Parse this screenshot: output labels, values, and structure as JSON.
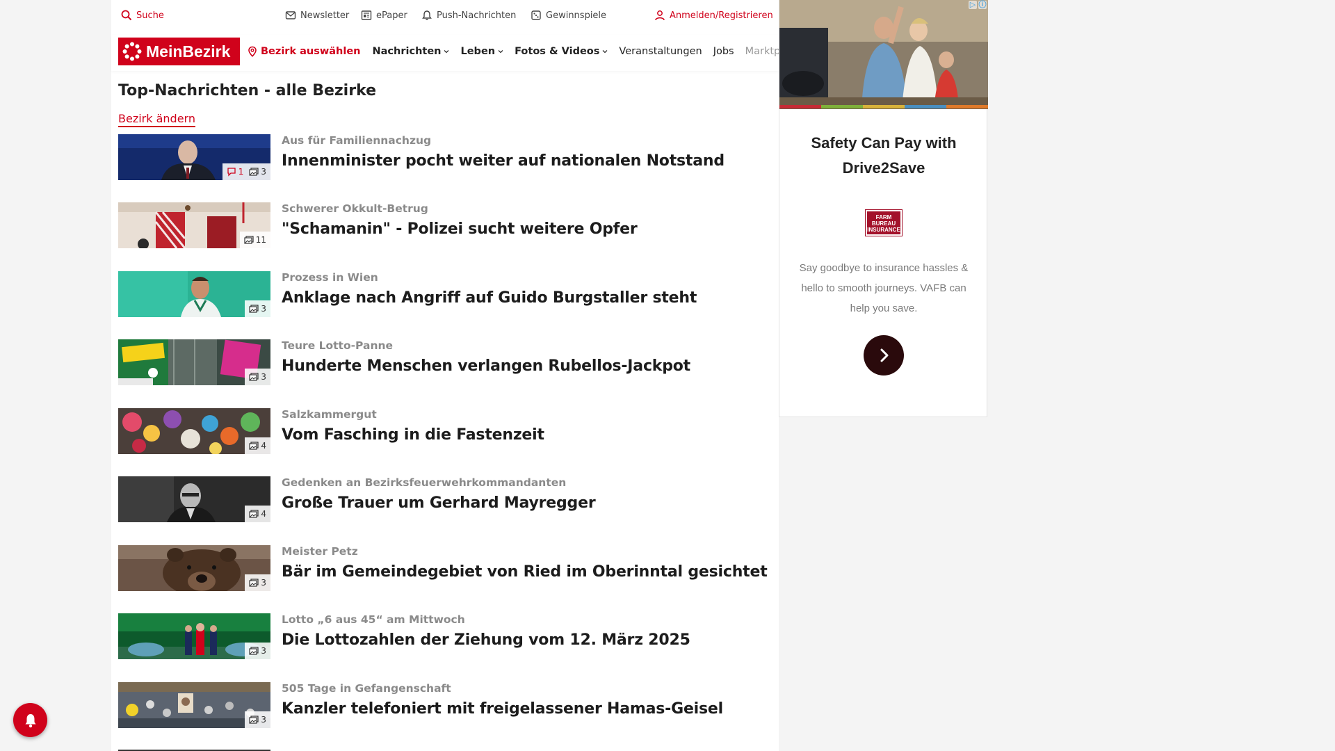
{
  "utility": {
    "search": "Suche",
    "newsletter": "Newsletter",
    "epaper": "ePaper",
    "push": "Push-Nachrichten",
    "games": "Gewinnspiele",
    "login": "Anmelden/Registrieren"
  },
  "nav": {
    "logo": "MeinBezirk",
    "bezirk": "Bezirk auswählen",
    "items": [
      {
        "label": "Nachrichten"
      },
      {
        "label": "Leben"
      },
      {
        "label": "Fotos & Videos"
      },
      {
        "label": "Veranstaltungen"
      },
      {
        "label": "Jobs"
      },
      {
        "label": "Marktplatz"
      }
    ]
  },
  "section": {
    "title": "Top-Nachrichten - alle Bezirke",
    "change": "Bezirk ändern"
  },
  "articles": [
    {
      "kicker": "Aus für Familiennachzug",
      "headline": "Innenminister pocht weiter auf nationalen Notstand",
      "comments": "1",
      "images": "3"
    },
    {
      "kicker": "Schwerer Okkult-Betrug",
      "headline": "\"Schamanin\" - Polizei sucht weitere Opfer",
      "images": "11"
    },
    {
      "kicker": "Prozess in Wien",
      "headline": "Anklage nach Angriff auf Guido Burgstaller steht",
      "images": "3"
    },
    {
      "kicker": "Teure Lotto-Panne",
      "headline": "Hunderte Menschen verlangen Rubellos-Jackpot",
      "images": "3"
    },
    {
      "kicker": "Salzkammergut",
      "headline": "Vom Fasching in die Fastenzeit",
      "images": "4"
    },
    {
      "kicker": "Gedenken an Bezirksfeuerwehrkommandanten",
      "headline": "Große Trauer um Gerhard Mayregger",
      "images": "4"
    },
    {
      "kicker": "Meister Petz",
      "headline": "Bär im Gemeindegebiet von Ried im Oberinntal gesichtet",
      "images": "3"
    },
    {
      "kicker": "Lotto „6 aus 45“ am Mittwoch",
      "headline": "Die Lottozahlen der Ziehung vom 12. März 2025",
      "images": "3"
    },
    {
      "kicker": "505 Tage in Gefangenschaft",
      "headline": "Kanzler telefoniert mit freigelassener Hamas-Geisel",
      "images": "3"
    }
  ],
  "ad": {
    "title": "Safety Can Pay with Drive2Save",
    "logo": "FARM BUREAU INSURANCE",
    "description": "Say goodbye to insurance hassles & hello to smooth journeys. VAFB can help you save."
  },
  "colors": {
    "brand": "#d0021b",
    "ad_cta": "#2a0a0c"
  },
  "icons": {
    "search": "search-icon",
    "newsletter": "mail-icon",
    "epaper": "newspaper-icon",
    "push": "bell-icon",
    "games": "dice-icon",
    "login": "user-icon",
    "bezirk": "location-pin-icon"
  }
}
